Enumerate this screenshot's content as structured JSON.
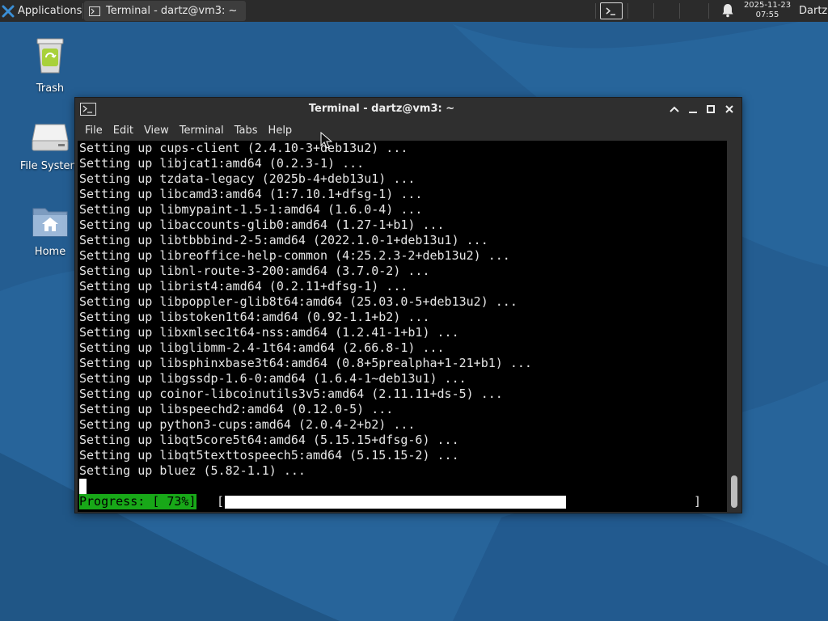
{
  "panel": {
    "applications_label": "Applications",
    "task_title": "Terminal - dartz@vm3: ~",
    "clock_date": "2025-11-23",
    "clock_time": "07:55",
    "user": "Dartz"
  },
  "desktop": {
    "icons": [
      {
        "label": "Trash",
        "icon": "trash-icon"
      },
      {
        "label": "File System",
        "icon": "drive-icon"
      },
      {
        "label": "Home",
        "icon": "home-folder-icon"
      }
    ]
  },
  "window": {
    "title": "Terminal - dartz@vm3: ~",
    "menu": [
      "File",
      "Edit",
      "View",
      "Terminal",
      "Tabs",
      "Help"
    ]
  },
  "terminal": {
    "lines": [
      "Setting up cups-client (2.4.10-3+deb13u2) ...",
      "Setting up libjcat1:amd64 (0.2.3-1) ...",
      "Setting up tzdata-legacy (2025b-4+deb13u1) ...",
      "Setting up libcamd3:amd64 (1:7.10.1+dfsg-1) ...",
      "Setting up libmypaint-1.5-1:amd64 (1.6.0-4) ...",
      "Setting up libaccounts-glib0:amd64 (1.27-1+b1) ...",
      "Setting up libtbbbind-2-5:amd64 (2022.1.0-1+deb13u1) ...",
      "Setting up libreoffice-help-common (4:25.2.3-2+deb13u2) ...",
      "Setting up libnl-route-3-200:amd64 (3.7.0-2) ...",
      "Setting up librist4:amd64 (0.2.11+dfsg-1) ...",
      "Setting up libpoppler-glib8t64:amd64 (25.03.0-5+deb13u2) ...",
      "Setting up libstoken1t64:amd64 (0.92-1.1+b2) ...",
      "Setting up libxmlsec1t64-nss:amd64 (1.2.41-1+b1) ...",
      "Setting up libglibmm-2.4-1t64:amd64 (2.66.8-1) ...",
      "Setting up libsphinxbase3t64:amd64 (0.8+5prealpha+1-21+b1) ...",
      "Setting up libgssdp-1.6-0:amd64 (1.6.4-1~deb13u1) ...",
      "Setting up coinor-libcoinutils3v5:amd64 (2.11.11+ds-5) ...",
      "Setting up libspeechd2:amd64 (0.12.0-5) ...",
      "Setting up python3-cups:amd64 (2.0.4-2+b2) ...",
      "Setting up libqt5core5t64:amd64 (5.15.15+dfsg-6) ...",
      "Setting up libqt5texttospeech5:amd64 (5.15.15-2) ...",
      "Setting up bluez (5.82-1.1) ..."
    ],
    "progress_label": "Progress: [ 73%]",
    "progress_open": "[",
    "progress_close": "]",
    "progress_fraction": 0.73
  },
  "colors": {
    "progress_green": "#18a818",
    "terminal_bg": "#000000",
    "panel_bg": "#2b2b2b",
    "wallpaper": "#255e92"
  }
}
